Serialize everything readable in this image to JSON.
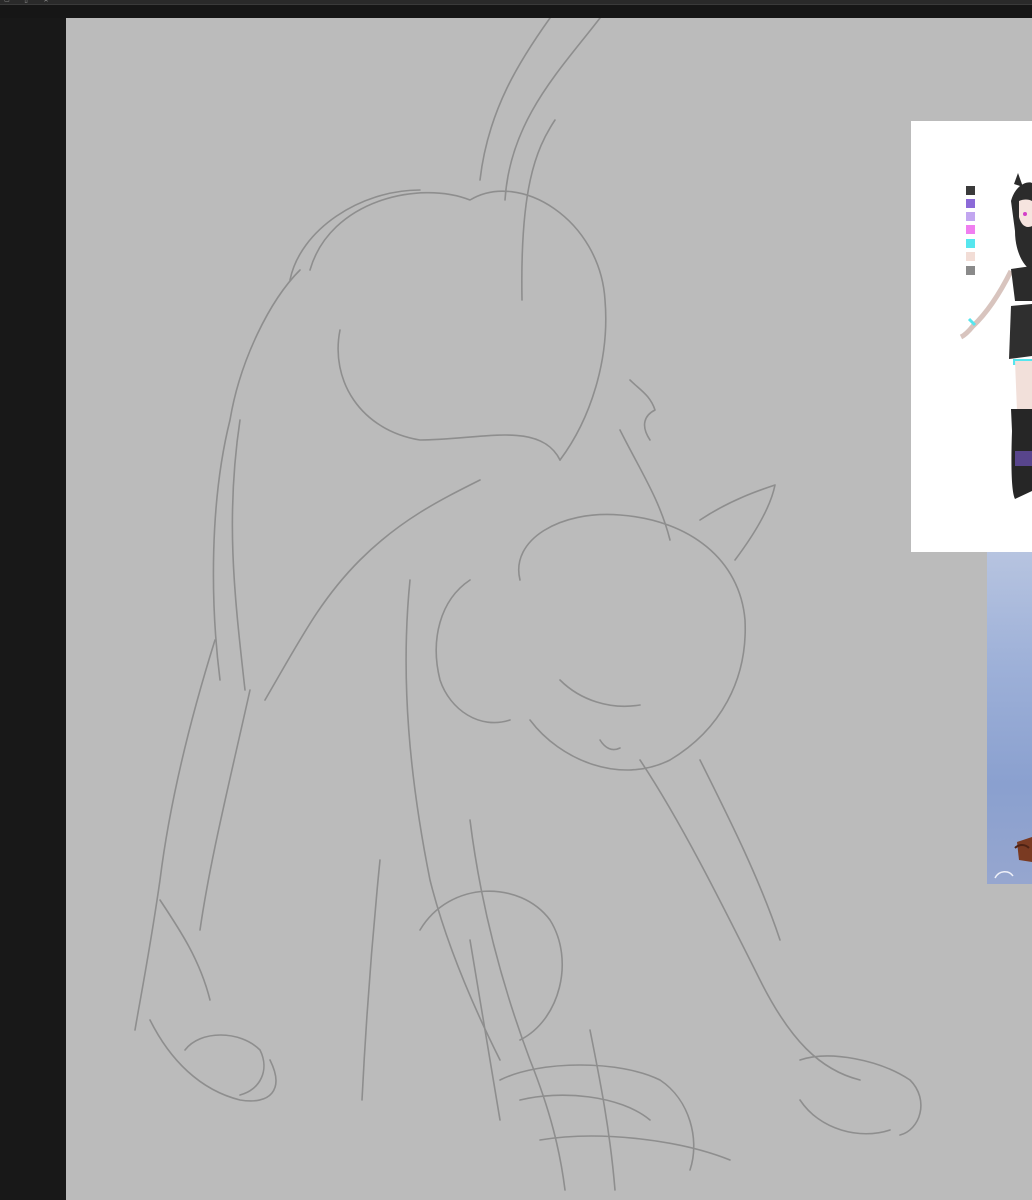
{
  "window": {
    "titlebar_icons": [
      "minimize-icon",
      "restore-icon",
      "close-icon"
    ],
    "titlebar_glyphs": [
      "▭",
      "▯",
      "✕"
    ]
  },
  "colors": {
    "canvas_bg": "#bbbbbb",
    "workspace_bg": "#181818",
    "sketch_line": "#8e8e8e"
  },
  "reference_sheet": {
    "palette": [
      "#3a3a3a",
      "#8c6ad8",
      "#c2a6f0",
      "#f07ef0",
      "#56e6ee",
      "#f2ddd6",
      "#8a8a8a"
    ]
  }
}
